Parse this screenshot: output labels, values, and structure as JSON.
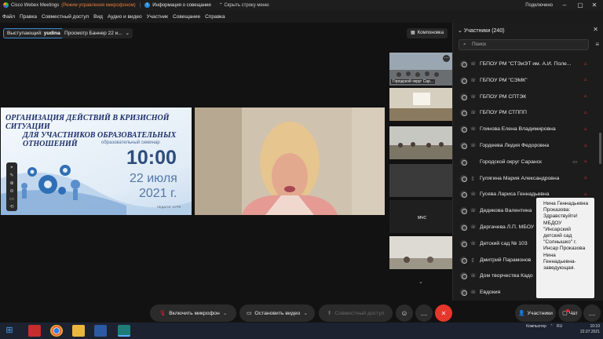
{
  "titlebar": {
    "app": "Cisco Webex Meetings",
    "mode": "(Режим управления микрофоном)",
    "meeting_info": "Информация о совещании",
    "hide_menu": "Скрыть строку меню",
    "status": "Подключено"
  },
  "menu": [
    "Файл",
    "Правка",
    "Совместный доступ",
    "Вид",
    "Аудио и видео",
    "Участник",
    "Совещание",
    "Справка"
  ],
  "stage": {
    "speaker_label": "Выступающий:",
    "speaker_name": "yudina",
    "viewing": "Просмотр Баннер 22 и...",
    "layout": "Компоновка"
  },
  "slide": {
    "headline_line1": "ОРГАНИЗАЦИЯ ДЕЙСТВИЙ В КРИЗИСНОЙ СИТУАЦИИ",
    "headline_line2": "ДЛЯ УЧАСТНИКОВ ОБРАЗОВАТЕЛЬНЫХ ОТНОШЕНИЙ",
    "subtitle": "образовательный семинар",
    "time": "10:00",
    "date_line1": "22 июля",
    "date_line2": "2021 г.",
    "footer": "ПЕДАГОГ 13 РФ"
  },
  "thumbnails": [
    {
      "caption": "Городской округ Сар..."
    },
    {
      "caption": ""
    },
    {
      "caption": ""
    },
    {
      "caption": ""
    },
    {
      "caption": "МЧС"
    },
    {
      "caption": ""
    }
  ],
  "panel": {
    "title": "Участники (240)",
    "search_placeholder": "Поиск",
    "participants": [
      {
        "name": "ГБПОУ РМ \"СТЭиЭТ им. А.И. Поле...",
        "device": "phone"
      },
      {
        "name": "ГБПОУ РМ \"СЭМК\"",
        "device": "phone"
      },
      {
        "name": "ГБПОУ РМ СПТЭК",
        "device": "phone"
      },
      {
        "name": "ГБПОУ РМ СТППП",
        "device": "phone"
      },
      {
        "name": "Глинова Елена Владимировна",
        "device": "phone"
      },
      {
        "name": "Гордеева Лидия Федоровна",
        "device": "phone"
      },
      {
        "name": "Городской округ Саранск",
        "device": "none",
        "camera": true
      },
      {
        "name": "Гулягина Мария Александровна",
        "device": "mobile"
      },
      {
        "name": "Гусева Лариса Геннадьевна",
        "device": "phone"
      },
      {
        "name": "Дедикова Валентина",
        "device": "phone"
      },
      {
        "name": "Дергачева Л.П. МБОУ",
        "device": "phone"
      },
      {
        "name": "Детский сад № 103",
        "device": "phone"
      },
      {
        "name": "Дмитрий Парамонов",
        "device": "mobile"
      },
      {
        "name": "Дом творчества Кадо",
        "device": "phone"
      },
      {
        "name": "Евдокия",
        "device": "phone"
      }
    ]
  },
  "chat_popup": {
    "text": "Нина Геннадьевна Проказова: Здравствуйте! МБДОУ \"Инсарский детский сад \"Солнышко\" г. Инсар Проказова Нина Геннадьевна- заведующая."
  },
  "controls": {
    "unmute": "Включить микрофон",
    "stop_video": "Остановить видео",
    "share": "Совместный доступ",
    "participants": "Участники",
    "chat": "Чат"
  },
  "taskbar": {
    "computer": "Компьютер",
    "lang": "RU",
    "time": "10:10",
    "date": "22.07.2021"
  },
  "colors": {
    "accent": "#3d8bd4",
    "leave": "#e5372c",
    "mute_red": "#d33333"
  }
}
